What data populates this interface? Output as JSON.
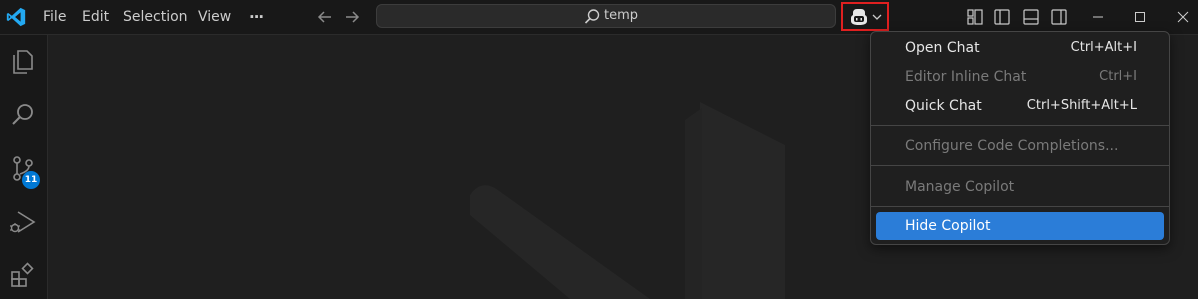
{
  "menubar": {
    "items": [
      "File",
      "Edit",
      "Selection",
      "View",
      "···"
    ]
  },
  "search": {
    "text": "temp"
  },
  "activity_bar": {
    "icons": [
      "explorer-icon",
      "search-icon",
      "source-control-icon",
      "run-debug-icon",
      "extensions-icon"
    ],
    "source_control_badge": "11"
  },
  "copilot_menu": {
    "items": [
      {
        "label": "Open Chat",
        "shortcut": "Ctrl+Alt+I",
        "state": "enabled"
      },
      {
        "label": "Editor Inline Chat",
        "shortcut": "Ctrl+I",
        "state": "disabled"
      },
      {
        "label": "Quick Chat",
        "shortcut": "Ctrl+Shift+Alt+L",
        "state": "enabled"
      },
      {
        "label": "Configure Code Completions...",
        "shortcut": "",
        "state": "disabled"
      },
      {
        "label": "Manage Copilot",
        "shortcut": "",
        "state": "disabled"
      },
      {
        "label": "Hide Copilot",
        "shortcut": "",
        "state": "highlighted"
      }
    ]
  },
  "colors": {
    "accent": "#0078d4",
    "highlight": "#2b7dd8",
    "annotation_box": "#e02020",
    "vscode_logo": "#23a9f2"
  }
}
